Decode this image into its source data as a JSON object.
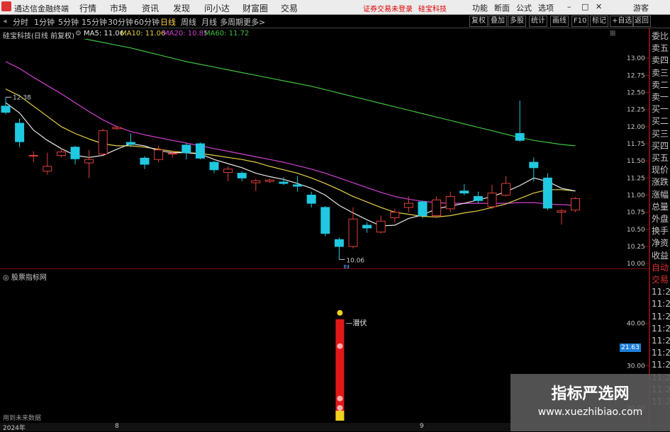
{
  "app": {
    "title": "通达信金融终端",
    "menus": [
      "行情",
      "市场",
      "资讯",
      "发现",
      "问小达",
      "财富圈",
      "交易"
    ],
    "login_status": "证券交易未登录",
    "stock_name": "硅宝科技",
    "right_menus": [
      "功能",
      "断面",
      "公式",
      "选项"
    ],
    "user": "游客"
  },
  "toolbar": {
    "periods": [
      "分时",
      "1分钟",
      "5分钟",
      "15分钟",
      "30分钟",
      "60分钟",
      "日线",
      "周线",
      "月线",
      "多周期",
      "更多>"
    ],
    "active_period": "日线",
    "buttons": [
      "复权",
      "叠加",
      "多股",
      "统计",
      "画线",
      "F10",
      "标记",
      "+自选",
      "返回"
    ]
  },
  "info": {
    "title": "硅宝科技(日线 前复权)",
    "ma5": "MA5: 11.06",
    "ma10": "MA10: 11.06",
    "ma20": "MA20: 10.85",
    "ma60": "MA60: 11.72"
  },
  "colors": {
    "up": "#e0403a",
    "down": "#20c8e0",
    "ma5": "#e8e8e8",
    "ma10": "#e8d048",
    "ma20": "#d040d0",
    "ma60": "#40c040",
    "grid": "#7a1010"
  },
  "chart_data": {
    "type": "candlestick",
    "ylim": [
      9.95,
      13.25
    ],
    "yticks": [
      "13.00",
      "12.75",
      "12.50",
      "12.25",
      "12.00",
      "11.75",
      "11.50",
      "11.25",
      "11.00",
      "10.75",
      "10.50",
      "10.25",
      "10.00"
    ],
    "ytick_values": [
      13.0,
      12.75,
      12.5,
      12.25,
      12.0,
      11.75,
      11.5,
      11.25,
      11.0,
      10.75,
      10.5,
      10.25,
      10.0
    ],
    "candles": [
      {
        "o": 12.3,
        "c": 12.21,
        "h": 12.43,
        "l": 12.18
      },
      {
        "o": 12.05,
        "c": 11.78,
        "h": 12.12,
        "l": 11.7
      },
      {
        "o": 11.57,
        "c": 11.58,
        "h": 11.64,
        "l": 11.48
      },
      {
        "o": 11.35,
        "c": 11.42,
        "h": 11.62,
        "l": 11.3
      },
      {
        "o": 11.58,
        "c": 11.63,
        "h": 11.68,
        "l": 11.55
      },
      {
        "o": 11.7,
        "c": 11.53,
        "h": 11.72,
        "l": 11.45
      },
      {
        "o": 11.47,
        "c": 11.52,
        "h": 11.66,
        "l": 11.25
      },
      {
        "o": 11.6,
        "c": 11.94,
        "h": 11.97,
        "l": 11.58
      },
      {
        "o": 11.97,
        "c": 11.99,
        "h": 12.0,
        "l": 11.95
      },
      {
        "o": 11.77,
        "c": 11.74,
        "h": 11.9,
        "l": 11.7
      },
      {
        "o": 11.54,
        "c": 11.45,
        "h": 11.57,
        "l": 11.38
      },
      {
        "o": 11.52,
        "c": 11.66,
        "h": 11.72,
        "l": 11.48
      },
      {
        "o": 11.6,
        "c": 11.61,
        "h": 11.64,
        "l": 11.55
      },
      {
        "o": 11.73,
        "c": 11.62,
        "h": 11.76,
        "l": 11.52
      },
      {
        "o": 11.75,
        "c": 11.54,
        "h": 11.77,
        "l": 11.52
      },
      {
        "o": 11.48,
        "c": 11.37,
        "h": 11.5,
        "l": 11.32
      },
      {
        "o": 11.33,
        "c": 11.38,
        "h": 11.42,
        "l": 11.2
      },
      {
        "o": 11.32,
        "c": 11.25,
        "h": 11.35,
        "l": 11.2
      },
      {
        "o": 11.18,
        "c": 11.21,
        "h": 11.24,
        "l": 11.06
      },
      {
        "o": 11.2,
        "c": 11.22,
        "h": 11.24,
        "l": 11.18
      },
      {
        "o": 11.19,
        "c": 11.17,
        "h": 11.26,
        "l": 11.15
      },
      {
        "o": 11.15,
        "c": 11.13,
        "h": 11.28,
        "l": 11.05
      },
      {
        "o": 11.0,
        "c": 10.88,
        "h": 11.05,
        "l": 10.82
      },
      {
        "o": 10.82,
        "c": 10.44,
        "h": 10.84,
        "l": 10.4
      },
      {
        "o": 10.35,
        "c": 10.25,
        "h": 10.38,
        "l": 10.06
      },
      {
        "o": 10.25,
        "c": 10.65,
        "h": 10.82,
        "l": 10.22
      },
      {
        "o": 10.56,
        "c": 10.52,
        "h": 10.6,
        "l": 10.45
      },
      {
        "o": 10.46,
        "c": 10.62,
        "h": 10.7,
        "l": 10.44
      },
      {
        "o": 10.67,
        "c": 10.75,
        "h": 10.8,
        "l": 10.6
      },
      {
        "o": 10.82,
        "c": 10.88,
        "h": 10.98,
        "l": 10.75
      },
      {
        "o": 10.9,
        "c": 10.7,
        "h": 10.92,
        "l": 10.66
      },
      {
        "o": 10.7,
        "c": 10.93,
        "h": 10.98,
        "l": 10.66
      },
      {
        "o": 10.8,
        "c": 10.98,
        "h": 11.05,
        "l": 10.75
      },
      {
        "o": 11.06,
        "c": 11.03,
        "h": 11.16,
        "l": 11.0
      },
      {
        "o": 10.98,
        "c": 10.92,
        "h": 11.05,
        "l": 10.88
      },
      {
        "o": 10.83,
        "c": 11.03,
        "h": 11.15,
        "l": 10.8
      },
      {
        "o": 11.0,
        "c": 11.17,
        "h": 11.28,
        "l": 10.98
      },
      {
        "o": 11.9,
        "c": 11.8,
        "h": 12.38,
        "l": 11.78
      },
      {
        "o": 11.48,
        "c": 11.4,
        "h": 11.55,
        "l": 11.2
      },
      {
        "o": 11.25,
        "c": 10.81,
        "h": 11.32,
        "l": 10.78
      },
      {
        "o": 10.75,
        "c": 10.77,
        "h": 10.8,
        "l": 10.57
      },
      {
        "o": 10.78,
        "c": 10.95,
        "h": 10.97,
        "l": 10.75
      }
    ],
    "ma5": [
      12.35,
      12.2,
      11.95,
      11.8,
      11.68,
      11.58,
      11.55,
      11.58,
      11.67,
      11.75,
      11.72,
      11.65,
      11.62,
      11.62,
      11.6,
      11.52,
      11.46,
      11.4,
      11.32,
      11.27,
      11.23,
      11.17,
      11.1,
      11.0,
      10.85,
      10.74,
      10.64,
      10.55,
      10.56,
      10.66,
      10.71,
      10.8,
      10.84,
      10.88,
      10.93,
      10.98,
      11.05,
      11.14,
      11.25,
      11.2,
      11.1,
      11.06
    ],
    "ma10": [
      12.55,
      12.45,
      12.3,
      12.15,
      12.0,
      11.9,
      11.82,
      11.75,
      11.72,
      11.72,
      11.7,
      11.67,
      11.64,
      11.62,
      11.61,
      11.58,
      11.55,
      11.52,
      11.48,
      11.42,
      11.37,
      11.32,
      11.25,
      11.17,
      11.08,
      10.98,
      10.9,
      10.82,
      10.75,
      10.72,
      10.69,
      10.68,
      10.7,
      10.74,
      10.77,
      10.82,
      10.87,
      10.95,
      11.03,
      11.08,
      11.08,
      11.06
    ],
    "ma20": [
      12.95,
      12.85,
      12.72,
      12.6,
      12.48,
      12.35,
      12.22,
      12.1,
      12.0,
      11.93,
      11.88,
      11.84,
      11.8,
      11.76,
      11.72,
      11.68,
      11.64,
      11.6,
      11.56,
      11.52,
      11.48,
      11.43,
      11.38,
      11.32,
      11.25,
      11.18,
      11.11,
      11.04,
      10.98,
      10.94,
      10.91,
      10.89,
      10.88,
      10.88,
      10.88,
      10.88,
      10.88,
      10.89,
      10.89,
      10.87,
      10.86,
      10.85
    ],
    "ma60": [
      13.45,
      13.43,
      13.41,
      13.38,
      13.35,
      13.31,
      13.27,
      13.23,
      13.19,
      13.15,
      13.1,
      13.05,
      13.0,
      12.95,
      12.91,
      12.87,
      12.83,
      12.79,
      12.75,
      12.71,
      12.67,
      12.63,
      12.59,
      12.54,
      12.49,
      12.44,
      12.39,
      12.34,
      12.29,
      12.24,
      12.19,
      12.14,
      12.09,
      12.04,
      11.99,
      11.94,
      11.89,
      11.84,
      11.8,
      11.77,
      11.74,
      11.72
    ],
    "high_label": "12.38",
    "low_label": "10.06",
    "low_mark": "财",
    "indicator": {
      "title": "股票指标网",
      "ylim": [
        17,
        50
      ],
      "yticks": [
        "40.00",
        "30.00",
        "20.00"
      ],
      "ytick_values": [
        40,
        30,
        20
      ],
      "bar_index": 24,
      "bar_top": 41,
      "bar_bottom": 17,
      "label": "潜伏",
      "current_value": "21.63"
    },
    "x_labels": [
      "2024年",
      "8",
      "9"
    ],
    "x_label_index": [
      0,
      8,
      30
    ]
  },
  "right_panel": [
    "委比",
    "卖五",
    "卖四",
    "卖三",
    "卖二",
    "卖一",
    "买一",
    "买二",
    "买三",
    "买四",
    "买五",
    "现价",
    "涨跌",
    "涨幅",
    "总量",
    "外盘",
    "换手",
    "净资",
    "收益",
    "自动",
    "交易",
    "11:2",
    "11:2",
    "11:2",
    "11:2",
    "11:2",
    "11:2",
    "11:2",
    "11:2",
    "11:2",
    "11:2"
  ],
  "footnote": "用到未来数据",
  "watermark": {
    "cn": "指标严选网",
    "url": "www.xuezhibiao.com"
  }
}
